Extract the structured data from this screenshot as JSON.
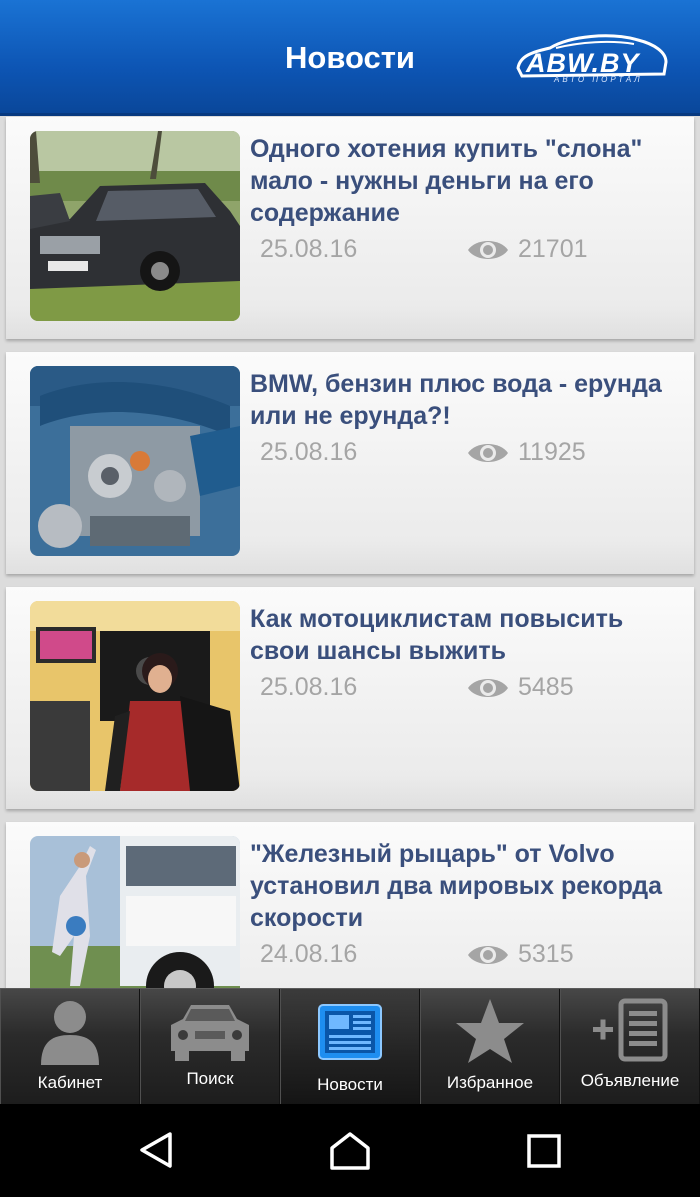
{
  "header": {
    "title": "Новости",
    "logo_text": "ABW.BY",
    "logo_subtitle": "АВТО ПОРТАЛ"
  },
  "articles": [
    {
      "title": "Одного хотения купить \"слона\" мало - нужны деньги на его содержание",
      "date": "25.08.16",
      "views": "21701",
      "thumb": "black-mercedes-sedan"
    },
    {
      "title": "BMW, бензин плюс вода - ерунда или не ерунда?!",
      "date": "25.08.16",
      "views": "11925",
      "thumb": "engine-cutaway"
    },
    {
      "title": "Как мотоциклистам повысить свои шансы выжить",
      "date": "25.08.16",
      "views": "5485",
      "thumb": "woman-in-moto-shop"
    },
    {
      "title": "\"Железный рыцарь\" от Volvo установил два мировых рекорда скорости",
      "date": "24.08.16",
      "views": "5315",
      "thumb": "volvo-truck-runner"
    }
  ],
  "tabs": [
    {
      "label": "Кабинет",
      "icon": "person-icon",
      "active": false
    },
    {
      "label": "Поиск",
      "icon": "car-icon",
      "active": false
    },
    {
      "label": "Новости",
      "icon": "news-icon",
      "active": true
    },
    {
      "label": "Избранное",
      "icon": "star-icon",
      "active": false
    },
    {
      "label": "Объявление",
      "icon": "add-listing-icon",
      "active": false
    }
  ],
  "colors": {
    "header_blue": "#0d55b4",
    "headline": "#3a4f7c",
    "meta_gray": "#a5a5a5",
    "active_tab_icon": "#1e8ef0"
  }
}
